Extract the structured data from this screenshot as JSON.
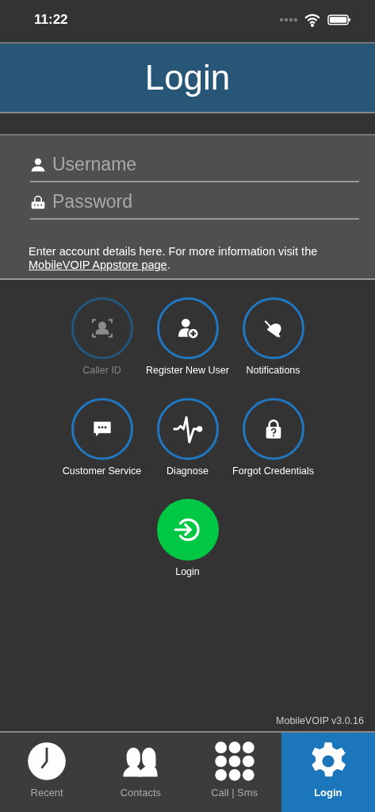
{
  "status_bar": {
    "time": "11:22"
  },
  "header": {
    "title": "Login"
  },
  "form": {
    "username": {
      "placeholder": "Username"
    },
    "password": {
      "placeholder": "Password"
    },
    "info": "Enter account details here. For more information visit the",
    "link": "MobileVOIP Appstore page",
    "link_end": "."
  },
  "actions": [
    {
      "kind": "callerid",
      "label": "Caller ID",
      "disabled": true
    },
    {
      "kind": "register",
      "label": "Register New User",
      "disabled": false
    },
    {
      "kind": "notifications",
      "label": "Notifications",
      "disabled": false
    },
    {
      "kind": "support",
      "label": "Customer Service",
      "disabled": false
    },
    {
      "kind": "diagnose",
      "label": "Diagnose",
      "disabled": false
    },
    {
      "kind": "recover",
      "label": "Forgot Credentials",
      "disabled": false
    }
  ],
  "login_button": {
    "label": "Login"
  },
  "version": "MobileVOIP v3.0.16",
  "tabs": [
    {
      "kind": "recent",
      "label": "Recent",
      "selected": false
    },
    {
      "kind": "contacts",
      "label": "Contacts",
      "selected": false
    },
    {
      "kind": "dialpad",
      "label": "Call | Sms",
      "selected": false
    },
    {
      "kind": "settings",
      "label": "Login",
      "selected": true
    }
  ]
}
